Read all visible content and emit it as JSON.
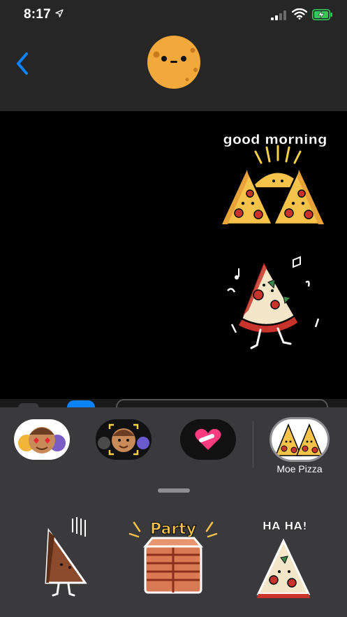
{
  "status_bar": {
    "time": "8:17"
  },
  "header": {
    "contact_avatar": "pizza-face-avatar"
  },
  "conversation": {
    "stickers": [
      {
        "name": "good-morning-pizza-sticker",
        "text": "good morning"
      },
      {
        "name": "dancing-pizza-sticker",
        "text": ""
      }
    ]
  },
  "app_drawer": {
    "apps": [
      {
        "name": "memoji-stickers-app"
      },
      {
        "name": "memoji-camera-app"
      },
      {
        "name": "digital-touch-app"
      },
      {
        "name": "moe-pizza-app",
        "label": "Moe Pizza"
      }
    ],
    "sticker_grid": [
      {
        "name": "falling-pizza-sticker",
        "text": ""
      },
      {
        "name": "party-pizza-box-sticker",
        "text": "Party"
      },
      {
        "name": "ha-ha-pizza-sticker",
        "text": "HA HA!"
      }
    ]
  },
  "colors": {
    "accent": "#0a84ff",
    "battery": "#34c759",
    "pizza_crust": "#f2b53b",
    "pepperoni": "#c8342b"
  }
}
